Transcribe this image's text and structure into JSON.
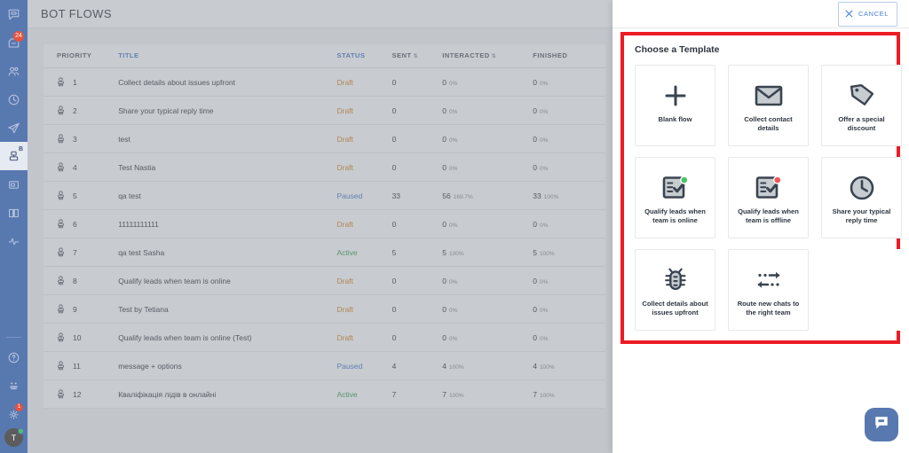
{
  "sidebar": {
    "items": [
      {
        "name": "chats",
        "icon": "chat-bubble-icon",
        "badge": "",
        "active": false
      },
      {
        "name": "inbox",
        "icon": "archive-icon",
        "badge": "24",
        "active": false
      },
      {
        "name": "contacts",
        "icon": "people-icon",
        "badge": "",
        "active": false
      },
      {
        "name": "history",
        "icon": "clock-icon",
        "badge": "",
        "active": false
      },
      {
        "name": "campaigns",
        "icon": "paper-plane-icon",
        "badge": "",
        "active": false
      },
      {
        "name": "bot-flows",
        "icon": "bot-icon",
        "badge": "B",
        "active": true
      },
      {
        "name": "saved-replies",
        "icon": "window-icon",
        "badge": "",
        "active": false
      },
      {
        "name": "knowledge-base",
        "icon": "book-icon",
        "badge": "",
        "active": false
      },
      {
        "name": "reports",
        "icon": "pulse-icon",
        "badge": "",
        "active": false
      }
    ],
    "bottom_items": [
      {
        "name": "help",
        "icon": "question-circle-icon",
        "badge": ""
      },
      {
        "name": "apps",
        "icon": "apps-icon",
        "badge": ""
      },
      {
        "name": "settings",
        "icon": "gear-icon",
        "badge": "1"
      }
    ],
    "avatar_initial": "T",
    "colors": {
      "rail": "#5878b0",
      "badge": "#e8523f",
      "active_bg": "#e6eaf2",
      "online": "#4ec16a"
    }
  },
  "header": {
    "page_title": "BOT FLOWS"
  },
  "table": {
    "columns": [
      {
        "key": "priority",
        "label": "PRIORITY",
        "sortable": false,
        "highlighted": false
      },
      {
        "key": "title",
        "label": "TITLE",
        "sortable": false,
        "highlighted": true
      },
      {
        "key": "status",
        "label": "STATUS",
        "sortable": false,
        "highlighted": true
      },
      {
        "key": "sent",
        "label": "SENT",
        "sortable": true,
        "highlighted": false
      },
      {
        "key": "interacted",
        "label": "INTERACTED",
        "sortable": true,
        "highlighted": false
      },
      {
        "key": "finished",
        "label": "FINISHED",
        "sortable": false,
        "highlighted": false
      }
    ],
    "sort_glyph": "⇅",
    "rows": [
      {
        "priority": "1",
        "title": "Collect details about issues upfront",
        "status": "Draft",
        "status_kind": "draft",
        "sent": "0",
        "interacted": "0",
        "interacted_pct": "0%",
        "finished": "0",
        "finished_pct": "0%"
      },
      {
        "priority": "2",
        "title": "Share your typical reply time",
        "status": "Draft",
        "status_kind": "draft",
        "sent": "0",
        "interacted": "0",
        "interacted_pct": "0%",
        "finished": "0",
        "finished_pct": "0%"
      },
      {
        "priority": "3",
        "title": "test",
        "status": "Draft",
        "status_kind": "draft",
        "sent": "0",
        "interacted": "0",
        "interacted_pct": "0%",
        "finished": "0",
        "finished_pct": "0%"
      },
      {
        "priority": "4",
        "title": "Test Nastia",
        "status": "Draft",
        "status_kind": "draft",
        "sent": "0",
        "interacted": "0",
        "interacted_pct": "0%",
        "finished": "0",
        "finished_pct": "0%"
      },
      {
        "priority": "5",
        "title": "qa test",
        "status": "Paused",
        "status_kind": "paused",
        "sent": "33",
        "interacted": "56",
        "interacted_pct": "169.7%",
        "finished": "33",
        "finished_pct": "100%"
      },
      {
        "priority": "6",
        "title": "11111111111",
        "status": "Draft",
        "status_kind": "draft",
        "sent": "0",
        "interacted": "0",
        "interacted_pct": "0%",
        "finished": "0",
        "finished_pct": "0%"
      },
      {
        "priority": "7",
        "title": "qa test Sasha",
        "status": "Active",
        "status_kind": "active",
        "sent": "5",
        "interacted": "5",
        "interacted_pct": "100%",
        "finished": "5",
        "finished_pct": "100%"
      },
      {
        "priority": "8",
        "title": "Qualify leads when team is online",
        "status": "Draft",
        "status_kind": "draft",
        "sent": "0",
        "interacted": "0",
        "interacted_pct": "0%",
        "finished": "0",
        "finished_pct": "0%"
      },
      {
        "priority": "9",
        "title": "Test by Tetiana",
        "status": "Draft",
        "status_kind": "draft",
        "sent": "0",
        "interacted": "0",
        "interacted_pct": "0%",
        "finished": "0",
        "finished_pct": "0%"
      },
      {
        "priority": "10",
        "title": "Qualify leads when team is online (Test)",
        "status": "Draft",
        "status_kind": "draft",
        "sent": "0",
        "interacted": "0",
        "interacted_pct": "0%",
        "finished": "0",
        "finished_pct": "0%"
      },
      {
        "priority": "11",
        "title": "message + options",
        "status": "Paused",
        "status_kind": "paused",
        "sent": "4",
        "interacted": "4",
        "interacted_pct": "100%",
        "finished": "4",
        "finished_pct": "100%"
      },
      {
        "priority": "12",
        "title": "Кваліфікація лідів в онлайні",
        "status": "Active",
        "status_kind": "active",
        "sent": "7",
        "interacted": "7",
        "interacted_pct": "100%",
        "finished": "7",
        "finished_pct": "100%"
      }
    ],
    "status_colors": {
      "draft": "#d9872c",
      "paused": "#4a7fd0",
      "active": "#3fa35e"
    }
  },
  "panel": {
    "cancel_label": "CANCEL",
    "cancel_icon": "close-x-icon",
    "choose_title": "Choose a Template",
    "highlight_color": "#ec1c24",
    "templates": [
      {
        "id": "blank-flow",
        "label": "Blank flow",
        "icon": "plus-icon"
      },
      {
        "id": "collect-contact",
        "label": "Collect contact details",
        "icon": "envelope-icon"
      },
      {
        "id": "offer-discount",
        "label": "Offer a special discount",
        "icon": "tag-icon"
      },
      {
        "id": "qualify-leads-online",
        "label": "Qualify leads when team is online",
        "icon": "checklist-online-icon"
      },
      {
        "id": "qualify-leads-offline",
        "label": "Qualify leads when team is offline",
        "icon": "checklist-offline-icon"
      },
      {
        "id": "share-reply-time",
        "label": "Share your typical reply time",
        "icon": "clock-icon"
      },
      {
        "id": "collect-issue-details",
        "label": "Collect details about issues upfront",
        "icon": "bug-icon"
      },
      {
        "id": "route-new-chats",
        "label": "Route new chats to the right team",
        "icon": "route-arrows-icon"
      }
    ]
  },
  "launcher": {
    "icon": "chat-bubble-icon",
    "color": "#5878b0"
  }
}
